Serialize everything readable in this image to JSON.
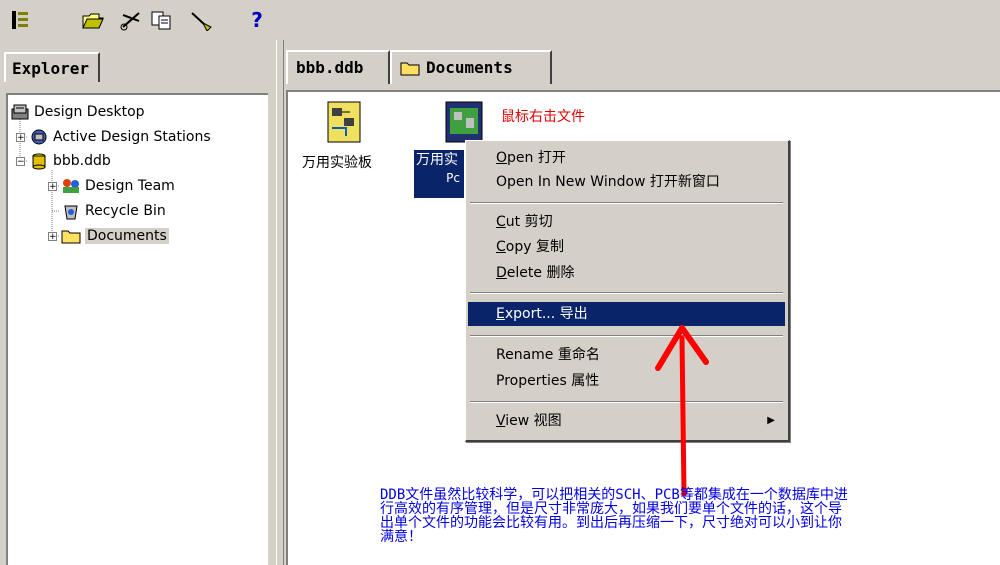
{
  "toolbar": {
    "buttons": [
      "tree-view-icon",
      "open-folder-icon",
      "cut-icon",
      "copy-icon",
      "paste-icon",
      "help-icon"
    ],
    "help_glyph": "?"
  },
  "explorer": {
    "tab_label": "Explorer",
    "tree": [
      {
        "label": "Design Desktop",
        "icon": "design-desktop-icon"
      },
      {
        "label": "Active Design Stations",
        "icon": "stations-icon"
      },
      {
        "label": "bbb.ddb",
        "icon": "database-icon"
      },
      {
        "label": "Design Team",
        "icon": "team-icon"
      },
      {
        "label": "Recycle Bin",
        "icon": "recycle-bin-icon"
      },
      {
        "label": "Documents",
        "icon": "folder-icon"
      }
    ]
  },
  "doc_tabs": [
    {
      "label": "bbb.ddb"
    },
    {
      "label": "Documents",
      "icon": "folder-icon"
    }
  ],
  "files": [
    {
      "label": "万用实验板"
    },
    {
      "label": "万用实",
      "sub": "Pc"
    }
  ],
  "annotation_red": "鼠标右击文件",
  "context_menu": {
    "items": [
      {
        "accel": "O",
        "rest": "pen 打开"
      },
      {
        "accel": "",
        "rest": "Open In New Window 打开新窗口"
      },
      {
        "accel": "C",
        "rest": "ut 剪切"
      },
      {
        "accel": "C",
        "rest": "opy 复制"
      },
      {
        "accel": "D",
        "rest": "elete 删除"
      },
      {
        "accel": "E",
        "rest": "xport... 导出"
      },
      {
        "accel": "",
        "rest": "Rename 重命名"
      },
      {
        "accel": "",
        "rest": "Properties 属性"
      },
      {
        "accel": "V",
        "rest": "iew 视图"
      }
    ],
    "submenu_arrow": "▶"
  },
  "annotation_blue": [
    "DDB文件虽然比较科学，可以把相关的SCH、PCB等都集成在一个数据库中进",
    "行高效的有序管理，但是尺寸非常庞大，如果我们要单个文件的话，这个导",
    "出单个文件的功能会比较有用。到出后再压缩一下，尺寸绝对可以小到让你",
    "满意！"
  ]
}
